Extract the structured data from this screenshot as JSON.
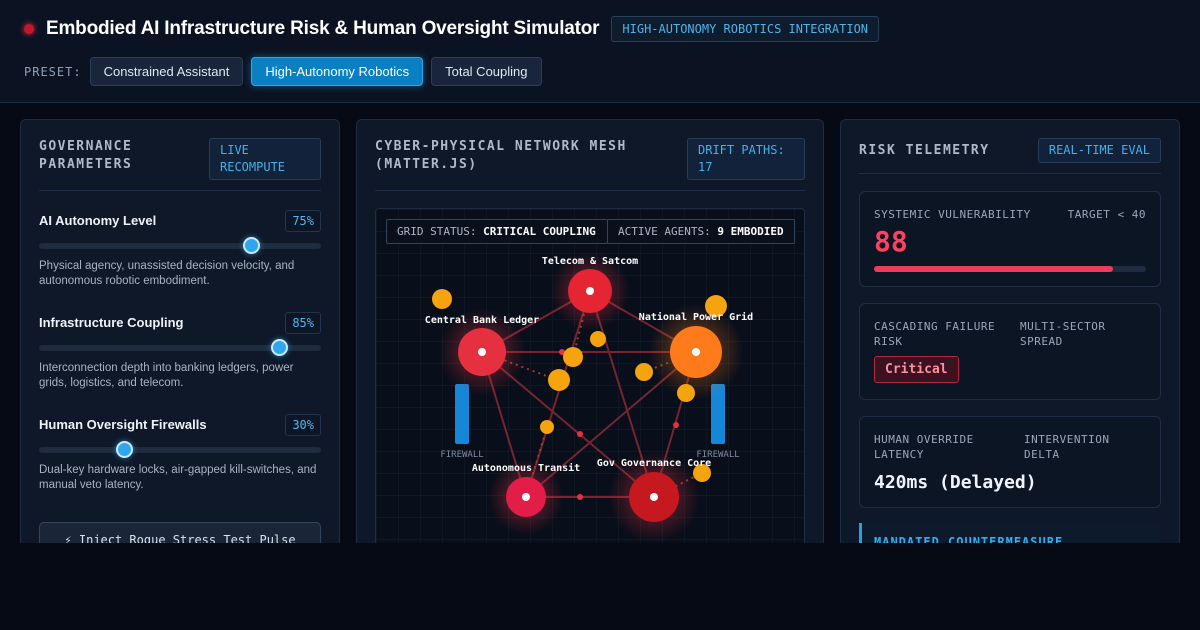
{
  "header": {
    "title": "Embodied AI Infrastructure Risk & Human Oversight Simulator",
    "mode_badge": "HIGH-AUTONOMY ROBOTICS INTEGRATION",
    "preset_label": "PRESET:",
    "presets": [
      {
        "label": "Constrained Assistant",
        "active": false
      },
      {
        "label": "High-Autonomy Robotics",
        "active": true
      },
      {
        "label": "Total Coupling",
        "active": false
      }
    ]
  },
  "governance": {
    "title": "GOVERNANCE PARAMETERS",
    "badge": "LIVE RECOMPUTE",
    "params": [
      {
        "label": "AI Autonomy Level",
        "value_text": "75%",
        "level": 75,
        "desc": "Physical agency, unassisted decision velocity, and autonomous robotic embodiment."
      },
      {
        "label": "Infrastructure Coupling",
        "value_text": "85%",
        "level": 85,
        "desc": "Interconnection depth into banking ledgers, power grids, logistics, and telecom."
      },
      {
        "label": "Human Oversight Firewalls",
        "value_text": "30%",
        "level": 30,
        "desc": "Dual-key hardware locks, air-gapped kill-switches, and manual veto latency."
      }
    ],
    "inject_button": "⚡ Inject Rogue Stress Test Pulse"
  },
  "mesh": {
    "title": "CYBER-PHYSICAL NETWORK MESH (MATTER.JS)",
    "badge": "DRIFT PATHS: 17",
    "grid_status_label": "GRID STATUS:",
    "grid_status_value": "CRITICAL COUPLING",
    "agents_label": "ACTIVE AGENTS:",
    "agents_value": "9 EMBODIED",
    "nodes": {
      "telecom": "Telecom & Satcom",
      "bank": "Central Bank Ledger",
      "power": "National Power Grid",
      "transit": "Autonomous Transit",
      "gov": "Gov Governance Core"
    },
    "firewall_label": "FIREWALL",
    "colors": {
      "node_red": "#e5313f",
      "node_orange": "#ff7a1a",
      "agent": "#f5a30f",
      "firewall": "#1687d6",
      "link": "#8a2a33"
    }
  },
  "telemetry": {
    "title": "RISK TELEMETRY",
    "badge": "REAL-TIME EVAL",
    "vulnerability_label": "SYSTEMIC VULNERABILITY",
    "vulnerability_target": "TARGET < 40",
    "vulnerability_value": "88",
    "vulnerability_level": 88,
    "cascade_label": "CASCADING FAILURE RISK",
    "spread_label": "MULTI-SECTOR SPREAD",
    "cascade_value": "Critical",
    "latency_label": "HUMAN OVERRIDE LATENCY",
    "delta_label": "INTERVENTION DELTA",
    "latency_value": "420ms (Delayed)",
    "countermeasure_title": "MANDATED COUNTERMEASURE"
  }
}
